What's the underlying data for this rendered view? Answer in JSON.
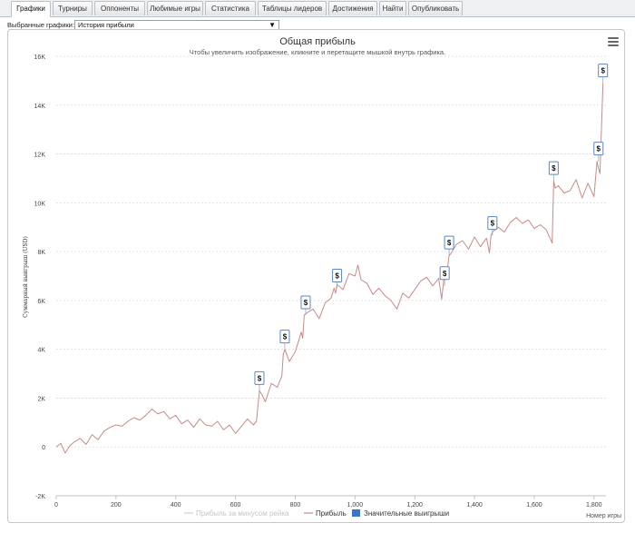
{
  "tabs": [
    "Графики",
    "Турниры",
    "Оппоненты",
    "Любимые игры",
    "Статистика",
    "Таблицы лидеров",
    "Достижения",
    "Найти",
    "Опубликовать"
  ],
  "active_tab_index": 0,
  "selector": {
    "label": "Выбранные графики:",
    "value": "История прибыли"
  },
  "chart_data": {
    "type": "line",
    "title": "Общая прибыль",
    "subtitle": "Чтобы увеличить изображение, кликните и перетащите мышкой внутрь графика.",
    "xlabel": "Номер игры",
    "ylabel": "Суммарный выигрыш (USD)",
    "xlim": [
      0,
      1840
    ],
    "ylim": [
      -2000,
      16000
    ],
    "x_ticks": [
      0,
      200,
      400,
      600,
      800,
      1000,
      1200,
      1400,
      1600,
      1800
    ],
    "x_tick_labels": [
      "0",
      "200",
      "400",
      "600",
      "800",
      "1,000",
      "1,200",
      "1,400",
      "1,600",
      "1,800"
    ],
    "y_ticks": [
      -2000,
      0,
      2000,
      4000,
      6000,
      8000,
      10000,
      12000,
      14000,
      16000
    ],
    "y_tick_labels": [
      "-2K",
      "0",
      "2K",
      "4K",
      "6K",
      "8K",
      "10K",
      "12K",
      "14K",
      "16K"
    ],
    "grid": {
      "x": false,
      "y": true,
      "style": "dashed"
    },
    "legend_position": "bottom-center",
    "series": [
      {
        "name": "Прибыль за минусом рейка",
        "color": "#cccccc",
        "visible": false,
        "x": [],
        "y": []
      },
      {
        "name": "Прибыль",
        "color": "#c88a8a",
        "visible": true,
        "x": [
          0,
          15,
          30,
          45,
          60,
          80,
          100,
          120,
          140,
          160,
          180,
          200,
          220,
          240,
          260,
          280,
          300,
          320,
          340,
          360,
          380,
          400,
          420,
          440,
          460,
          480,
          500,
          520,
          540,
          560,
          580,
          600,
          620,
          640,
          660,
          670,
          680,
          690,
          700,
          720,
          740,
          755,
          760,
          765,
          780,
          800,
          820,
          825,
          830,
          840,
          860,
          880,
          900,
          920,
          930,
          935,
          940,
          960,
          980,
          1000,
          1010,
          1020,
          1040,
          1060,
          1080,
          1100,
          1120,
          1140,
          1160,
          1180,
          1200,
          1220,
          1240,
          1260,
          1280,
          1290,
          1295,
          1300,
          1310,
          1315,
          1320,
          1330,
          1340,
          1360,
          1380,
          1400,
          1420,
          1440,
          1450,
          1455,
          1460,
          1480,
          1500,
          1520,
          1540,
          1560,
          1580,
          1600,
          1620,
          1640,
          1660,
          1665,
          1670,
          1680,
          1700,
          1720,
          1740,
          1760,
          1780,
          1800,
          1810,
          1815,
          1820,
          1830
        ],
        "y": [
          0,
          150,
          -250,
          50,
          200,
          350,
          100,
          500,
          300,
          650,
          800,
          900,
          850,
          1050,
          1200,
          1100,
          1300,
          1550,
          1350,
          1450,
          1150,
          1300,
          950,
          1100,
          800,
          1150,
          900,
          850,
          1050,
          700,
          900,
          550,
          850,
          1150,
          900,
          1050,
          2300,
          2100,
          1850,
          2600,
          2450,
          2900,
          3800,
          4000,
          3500,
          3900,
          4700,
          4450,
          5400,
          5500,
          5650,
          5250,
          5900,
          6100,
          6500,
          6300,
          6650,
          6450,
          7100,
          7000,
          7450,
          6850,
          6700,
          6250,
          6500,
          6200,
          6000,
          5650,
          6300,
          6100,
          6450,
          6800,
          6950,
          6600,
          6900,
          6050,
          6600,
          7200,
          7350,
          7850,
          7900,
          8100,
          8300,
          8450,
          8100,
          8600,
          8200,
          8550,
          7950,
          8650,
          8800,
          9000,
          8800,
          9200,
          9400,
          9150,
          9300,
          8950,
          9100,
          8900,
          8350,
          10900,
          10600,
          10700,
          10400,
          10500,
          10950,
          10200,
          10800,
          10250,
          11700,
          11400,
          11200,
          14900
        ]
      }
    ],
    "significant_wins": {
      "name": "Значительные выигрыши",
      "color": "#3a78c4",
      "marker_label": "$",
      "x": [
        680,
        765,
        835,
        940,
        1300,
        1315,
        1460,
        1665,
        1815,
        1830
      ],
      "y": [
        2300,
        4000,
        5400,
        6500,
        6600,
        7850,
        8650,
        10900,
        11700,
        14900
      ]
    }
  }
}
